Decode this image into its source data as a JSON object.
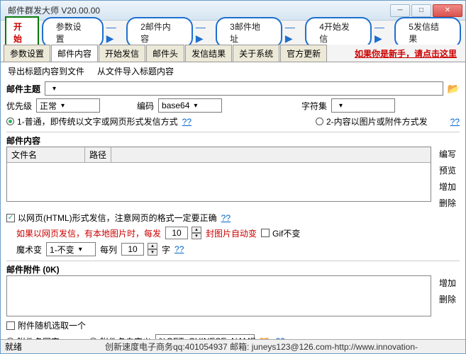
{
  "window": {
    "title": "邮件群发大师 V20.00.00"
  },
  "steps": {
    "start": "开始",
    "s1": "参数设置",
    "s2": "2邮件内容",
    "s3": "3邮件地址",
    "s4": "4开始发信",
    "s5": "5发信结果"
  },
  "tabs": {
    "t1": "参数设置",
    "t2": "邮件内容",
    "t3": "开始发信",
    "t4": "邮件头",
    "t5": "发信结果",
    "t6": "关于系统",
    "t7": "官方更新",
    "newbie": "如果你是新手，请点击这里"
  },
  "toolbar2": {
    "export": "导出标题内容到文件",
    "import": "从文件导入标题内容"
  },
  "subject": {
    "label": "邮件主题"
  },
  "priority": {
    "label": "优先级",
    "value": "正常"
  },
  "encoding": {
    "label": "编码",
    "value": "base64"
  },
  "charset": {
    "label": "字符集",
    "value": ""
  },
  "mode": {
    "r1": "1-普通，即传统以文字或网页形式发信方式",
    "r2": "2-内容以图片或附件方式发",
    "q": "??"
  },
  "contentSection": {
    "label": "邮件内容",
    "col1": "文件名",
    "col2": "路径",
    "btnEdit": "编写",
    "btnPreview": "预览",
    "btnAdd": "增加",
    "btnDel": "删除"
  },
  "html": {
    "check": "以网页(HTML)形式发信，注意网页的格式一定要正确",
    "q": "??",
    "warn": "如果以网页发信，有本地图片时，每发",
    "num1": "10",
    "seal": "封图片自动变",
    "gif": "Gif不变",
    "magic": "魔术变",
    "magicval": "1-不变",
    "percol": "每列",
    "num2": "10",
    "word": "字"
  },
  "attach": {
    "label": "邮件附件 (0K)",
    "add": "增加",
    "del": "删除",
    "rand": "附件随机选取一个",
    "fixed": "附件名固定",
    "custom": "附件名自定义",
    "customval": "%GET_CHINESE_NAME",
    "q": "??"
  },
  "status": {
    "ready": "就绪",
    "info": "创新速度电子商务qq:401054937   邮箱: juneys123@126.com-http://www.innovation-"
  }
}
